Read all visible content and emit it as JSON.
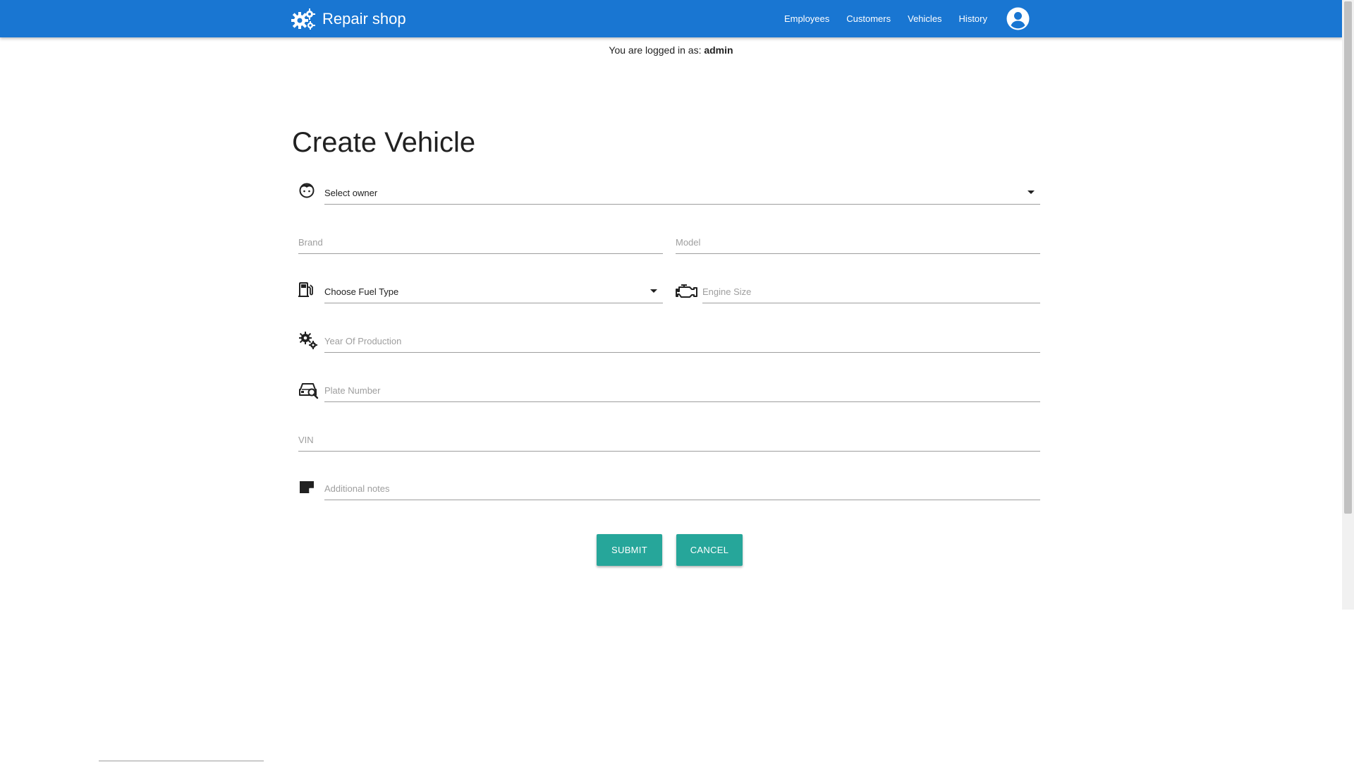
{
  "navbar": {
    "brand": "Repair shop",
    "brand_icon": "gears-icon",
    "links": [
      "Employees",
      "Customers",
      "Vehicles",
      "History"
    ],
    "avatar_icon": "account-circle-icon",
    "color": "#1976d2"
  },
  "login": {
    "prefix": "You are logged in as:",
    "username": "admin"
  },
  "page": {
    "title": "Create Vehicle"
  },
  "form": {
    "owner": {
      "value": "Select owner",
      "icon": "owner-face-icon"
    },
    "brand": {
      "placeholder": "Brand"
    },
    "model": {
      "placeholder": "Model"
    },
    "fuel": {
      "value": "Choose Fuel Type",
      "icon": "fuel-pump-icon"
    },
    "engine": {
      "placeholder": "Engine Size",
      "icon": "engine-icon"
    },
    "year": {
      "placeholder": "Year Of Production",
      "icon": "gears-icon"
    },
    "plate": {
      "placeholder": "Plate Number",
      "icon": "car-search-icon"
    },
    "vin": {
      "placeholder": "VIN"
    },
    "notes": {
      "placeholder": "Additional notes",
      "icon": "note-icon"
    }
  },
  "buttons": {
    "submit": "Submit",
    "cancel": "Cancel",
    "color": "#26a69a"
  }
}
